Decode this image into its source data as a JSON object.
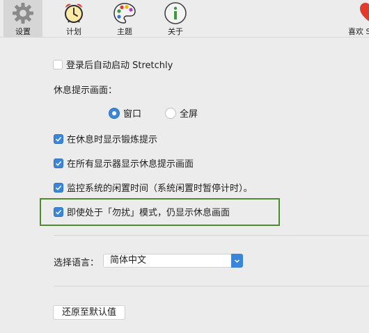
{
  "toolbar": {
    "items": [
      {
        "label": "设置",
        "icon": "gear-icon"
      },
      {
        "label": "计划",
        "icon": "alarm-clock-icon"
      },
      {
        "label": "主题",
        "icon": "palette-icon"
      },
      {
        "label": "关于",
        "icon": "info-icon"
      },
      {
        "label": "喜欢 S",
        "icon": "heart-icon"
      }
    ]
  },
  "settings": {
    "autostart": {
      "label": "登录后自动启动 Stretchly",
      "checked": false
    },
    "break_display_label": "休息提示画面：",
    "break_display_options": [
      {
        "label": "窗口",
        "selected": true
      },
      {
        "label": "全屏",
        "selected": false
      }
    ],
    "show_exercise": {
      "label": "在休息时显示锻炼提示",
      "checked": true
    },
    "all_monitors": {
      "label": "在所有显示器显示休息提示画面",
      "checked": true
    },
    "monitor_idle": {
      "label": "监控系统的闲置时间（系统闲置时暂停计时）。",
      "checked": true
    },
    "dnd_mode": {
      "label": "即使处于「勿扰」模式，仍显示休息画面",
      "checked": true
    },
    "language_label": "选择语言：",
    "language_value": "简体中文",
    "reset_button": "还原至默认值"
  },
  "colors": {
    "accent": "#3b86d8",
    "highlight_border": "#4c8c2a",
    "background": "#ececec"
  }
}
